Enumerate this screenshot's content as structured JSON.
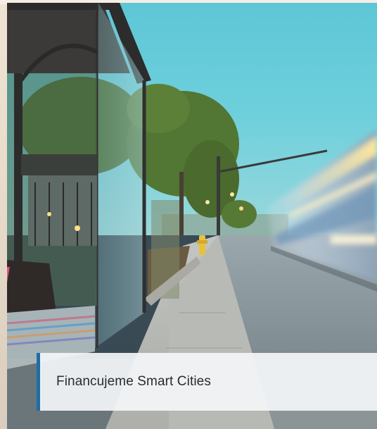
{
  "hero": {
    "image_description_icon": "street-bus-stop-photo",
    "caption": "Financujeme Smart Cities",
    "accent_color": "#1d6da6"
  }
}
